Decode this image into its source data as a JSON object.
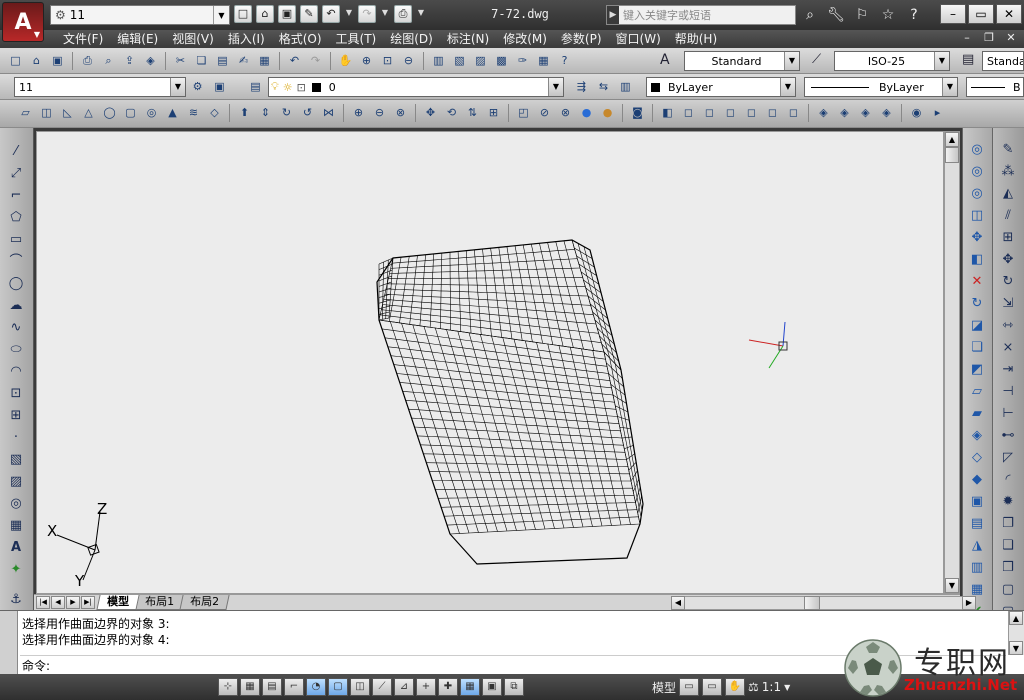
{
  "title_bar": {
    "app_logo": "A",
    "workspace": "11",
    "document_title": "7-72.dwg",
    "search_placeholder": "键入关键字或短语"
  },
  "menu": {
    "items": [
      "文件(F)",
      "编辑(E)",
      "视图(V)",
      "插入(I)",
      "格式(O)",
      "工具(T)",
      "绘图(D)",
      "标注(N)",
      "修改(M)",
      "参数(P)",
      "窗口(W)",
      "帮助(H)"
    ]
  },
  "styles_toolbar": {
    "text_style": "Standard",
    "dim_style": "ISO-25",
    "table_style": "Standard"
  },
  "layers_toolbar": {
    "workspace_combo": "11",
    "layer_combo": "0",
    "color_combo": "ByLayer",
    "linetype_combo": "ByLayer",
    "lineweight_combo": "B"
  },
  "layout_tabs": [
    "模型",
    "布局1",
    "布局2"
  ],
  "ucs_icon": {
    "x_label": "X",
    "y_label": "Y",
    "z_label": "Z"
  },
  "command_area": {
    "history": [
      "选择用作曲面边界的对象 3:",
      "选择用作曲面边界的对象 4:"
    ],
    "prompt": "命令:"
  },
  "status_bar": {
    "model_label": "模型",
    "annotation_scale": "1:1"
  },
  "watermark": {
    "cn_text": "专职网",
    "en_text": "Zhuanzhi.Net"
  },
  "colors": {
    "canvas_bg": "#ececec",
    "titlebar_bg": "#3a3a3a",
    "app_button": "#b82828",
    "ucs_x": "#cc2222",
    "ucs_y": "#22aa22",
    "ucs_z": "#2244cc"
  },
  "icons": {
    "app": "autocad-logo",
    "drawing_tools": [
      "line",
      "construction-line",
      "polyline",
      "polygon",
      "rectangle",
      "arc",
      "circle",
      "revision-cloud",
      "spline",
      "ellipse",
      "ellipse-arc",
      "insert-block",
      "make-block",
      "point",
      "hatch",
      "gradient",
      "region",
      "table",
      "multiline-text",
      "add-selected"
    ]
  }
}
